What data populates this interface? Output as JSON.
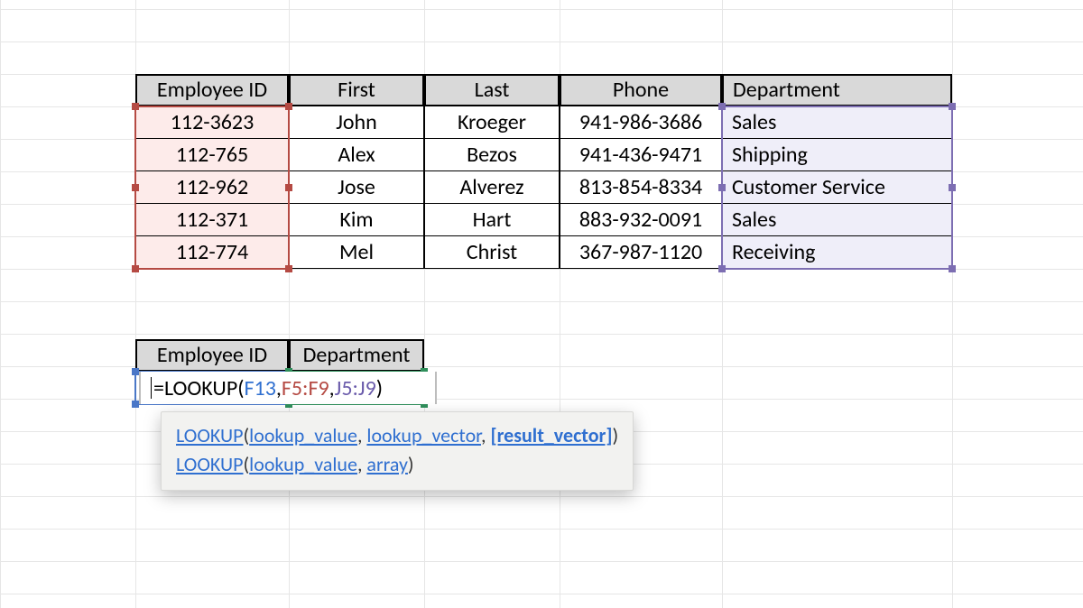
{
  "table": {
    "headers": [
      "Employee ID",
      "First",
      "Last",
      "Phone",
      "Department"
    ],
    "rows": [
      {
        "id": "112-3623",
        "first": "John",
        "last": "Kroeger",
        "phone": "941-986-3686",
        "dept": "Sales"
      },
      {
        "id": "112-765",
        "first": "Alex",
        "last": "Bezos",
        "phone": "941-436-9471",
        "dept": "Shipping"
      },
      {
        "id": "112-962",
        "first": "Jose",
        "last": "Alverez",
        "phone": "813-854-8334",
        "dept": "Customer Service"
      },
      {
        "id": "112-371",
        "first": "Kim",
        "last": "Hart",
        "phone": "883-932-0091",
        "dept": "Sales"
      },
      {
        "id": "112-774",
        "first": "Mel",
        "last": "Christ",
        "phone": "367-987-1120",
        "dept": "Receiving"
      }
    ]
  },
  "lookupTable": {
    "headers": [
      "Employee ID",
      "Department"
    ]
  },
  "formula": {
    "prefix": "=LOOKUP(",
    "arg1": "F13",
    "sep1": ",",
    "arg2": "F5:F9",
    "sep2": ",",
    "arg3": "J5:J9",
    "suffix": ")"
  },
  "tooltip": {
    "line1": {
      "fn": "LOOKUP",
      "open": "(",
      "a1": "lookup_value",
      "c1": ", ",
      "a2": "lookup_vector",
      "c2": ", ",
      "a3": "[result_vector]",
      "close": ")"
    },
    "line2": {
      "fn": "LOOKUP",
      "open": "(",
      "a1": "lookup_value",
      "c1": ", ",
      "a2": "array",
      "close": ")"
    }
  }
}
